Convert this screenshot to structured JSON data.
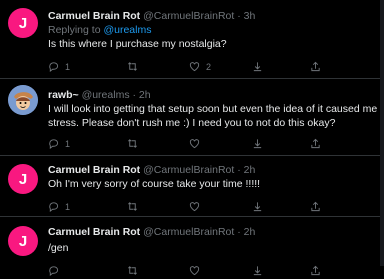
{
  "theme": {
    "background": "#000000",
    "text": "#e7e9ea",
    "secondary": "#71767b",
    "accent": "#1d9bf0",
    "avatar_pink": "#f91880"
  },
  "tweets": [
    {
      "avatar_letter": "J",
      "name": "Carmuel Brain Rot",
      "handle": "@CarmuelBrainRot",
      "dot": "·",
      "time": "3h",
      "replying_prefix": "Replying to",
      "replying_to": "@urealms",
      "text": "Is this where I purchase my nostalgia?",
      "reply_count": "1",
      "like_count": "2"
    },
    {
      "avatar_icon": "cartoon-avatar",
      "name": "rawb~",
      "handle": "@urealms",
      "dot": "·",
      "time": "2h",
      "text": "I will look into getting that setup soon but even the idea of it caused me stress. Please don't rush me :) I need you to not do this okay?",
      "reply_count": "1",
      "like_count": ""
    },
    {
      "avatar_letter": "J",
      "name": "Carmuel Brain Rot",
      "handle": "@CarmuelBrainRot",
      "dot": "·",
      "time": "2h",
      "text": "Oh I'm very sorry of course take your time !!!!!",
      "reply_count": "1",
      "like_count": ""
    },
    {
      "avatar_letter": "J",
      "name": "Carmuel Brain Rot",
      "handle": "@CarmuelBrainRot",
      "dot": "·",
      "time": "2h",
      "text": "/gen",
      "reply_count": "",
      "like_count": ""
    }
  ]
}
